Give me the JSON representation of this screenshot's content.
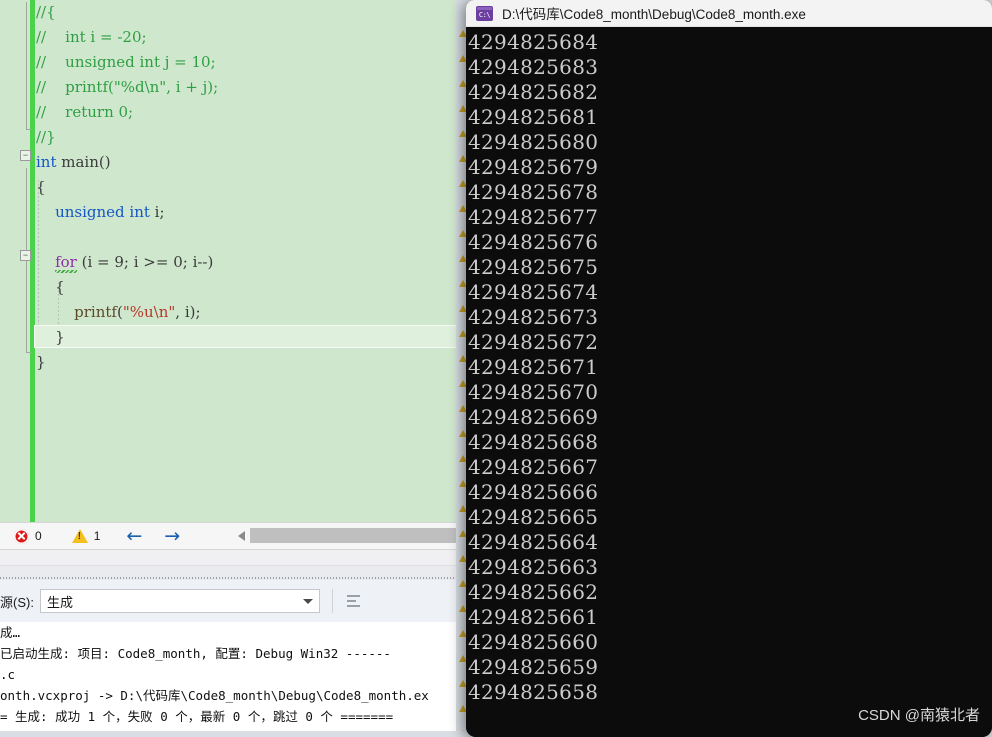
{
  "editor": {
    "code_lines": [
      [
        {
          "t": "//{",
          "c": "cmt"
        }
      ],
      [
        {
          "t": "//    int i = -20;",
          "c": "cmt"
        }
      ],
      [
        {
          "t": "//    unsigned int j = 10;",
          "c": "cmt"
        }
      ],
      [
        {
          "t": "//    printf(\"%d\\n\", i + j);",
          "c": "cmt"
        }
      ],
      [
        {
          "t": "//    return 0;",
          "c": "cmt"
        }
      ],
      [
        {
          "t": "//}",
          "c": "cmt"
        }
      ],
      [
        {
          "t": "int",
          "c": "kw"
        },
        {
          "t": " main()",
          "c": "pl"
        }
      ],
      [
        {
          "t": "{",
          "c": "pl"
        }
      ],
      [
        {
          "t": "    ",
          "c": "pl"
        },
        {
          "t": "unsigned int",
          "c": "kw"
        },
        {
          "t": " i;",
          "c": "pl"
        }
      ],
      [
        {
          "t": "",
          "c": "pl"
        }
      ],
      [
        {
          "t": "    ",
          "c": "pl"
        },
        {
          "t": "for",
          "c": "kw2"
        },
        {
          "t": " (i = 9; i >= 0; i--)",
          "c": "pl"
        }
      ],
      [
        {
          "t": "    {",
          "c": "pl"
        }
      ],
      [
        {
          "t": "        ",
          "c": "pl"
        },
        {
          "t": "printf",
          "c": "fn"
        },
        {
          "t": "(",
          "c": "pl"
        },
        {
          "t": "\"%u",
          "c": "str"
        },
        {
          "t": "\\n",
          "c": "esc"
        },
        {
          "t": "\"",
          "c": "str"
        },
        {
          "t": ", i);",
          "c": "pl"
        }
      ],
      [
        {
          "t": "    }",
          "c": "pl"
        }
      ],
      [
        {
          "t": "}",
          "c": "pl"
        }
      ]
    ],
    "collapse_glyph": "−"
  },
  "error_list": {
    "error_count": "0",
    "warning_count": "1",
    "prev_arrow": "←",
    "next_arrow": "→"
  },
  "output_panel": {
    "source_label": "源(S):",
    "source_value": "生成",
    "lines": [
      "成…",
      "已启动生成: 项目: Code8_month, 配置: Debug Win32 ------",
      ".c",
      "onth.vcxproj -> D:\\代码库\\Code8_month\\Debug\\Code8_month.ex",
      "= 生成: 成功 1 个，失败 0 个，最新 0 个，跳过 0 个 ======="
    ]
  },
  "console": {
    "title": "D:\\代码库\\Code8_month\\Debug\\Code8_month.exe",
    "icon_label": "C:\\",
    "output_lines": [
      "4294825684",
      "4294825683",
      "4294825682",
      "4294825681",
      "4294825680",
      "4294825679",
      "4294825678",
      "4294825677",
      "4294825676",
      "4294825675",
      "4294825674",
      "4294825673",
      "4294825672",
      "4294825671",
      "4294825670",
      "4294825669",
      "4294825668",
      "4294825667",
      "4294825666",
      "4294825665",
      "4294825664",
      "4294825663",
      "4294825662",
      "4294825661",
      "4294825660",
      "4294825659",
      "4294825658"
    ],
    "watermark": "CSDN @南猿北者"
  },
  "colors": {
    "editor_bg": "#cfe8cd",
    "console_bg": "#0c0c0c",
    "console_fg": "#cccccc",
    "change_bar": "#4ad34a",
    "error_red": "#d81b1b",
    "warning_yellow": "#f4c020",
    "keyword_blue": "#1456c8",
    "comment_green": "#2f9e44",
    "string_red": "#b5392b",
    "keyword_purple": "#8b2fa8"
  }
}
